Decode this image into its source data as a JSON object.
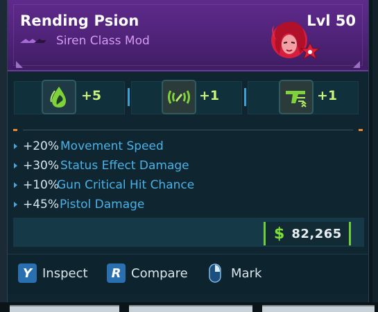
{
  "item": {
    "name": "Rending Psion",
    "level": "Lvl 50",
    "type": "Siren Class Mod",
    "rarity_color": "#b56de8"
  },
  "skills": [
    {
      "icon": "water-drop-skill-icon",
      "value": "+5"
    },
    {
      "icon": "radar-pulse-skill-icon",
      "value": "+1"
    },
    {
      "icon": "gun-boost-skill-icon",
      "value": "+1"
    }
  ],
  "stats": [
    {
      "amount": "+20%",
      "name": "Movement Speed"
    },
    {
      "amount": "+30%",
      "name": "Status Effect Damage"
    },
    {
      "amount": "+10%",
      "name": "Gun Critical Hit Chance"
    },
    {
      "amount": "+45%",
      "name": "Pistol Damage"
    }
  ],
  "price": {
    "symbol": "$",
    "value": "82,265"
  },
  "controls": [
    {
      "key": "Y",
      "label": "Inspect"
    },
    {
      "key": "R",
      "label": "Compare"
    },
    {
      "key": "mouse-icon",
      "label": "Mark"
    }
  ],
  "colors": {
    "header_purple": "#5f2a8c",
    "stat_blue": "#4bb1e6",
    "skill_green": "#c9f27a",
    "price_green": "#7fe03a",
    "key_blue": "#2a6fb0"
  }
}
